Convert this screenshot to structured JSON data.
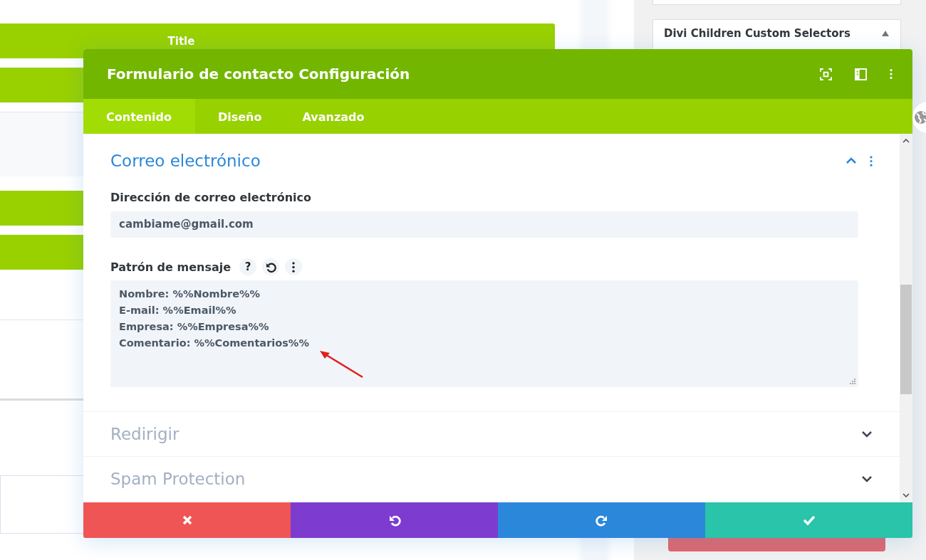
{
  "background": {
    "bar_title": "Title",
    "sidebar_panel": {
      "title": "Divi Children Custom Selectors",
      "expanded": true
    }
  },
  "modal": {
    "title": "Formulario de contacto Configuración",
    "tabs": [
      {
        "label": "Contenido",
        "selected": true
      },
      {
        "label": "Diseño",
        "selected": false
      },
      {
        "label": "Avanzado",
        "selected": false
      }
    ],
    "sections": [
      {
        "title": "Correo electrónico",
        "expanded": true,
        "fields": [
          {
            "kind": "input",
            "label": "Dirección de correo electrónico",
            "value": "cambiame@gmail.com"
          },
          {
            "kind": "textarea",
            "label": "Patrón de mensaje",
            "help_buttons": [
              "?"
            ],
            "lines": [
              "Nombre: %%Nombre%%",
              "E-mail: %%Email%%",
              "Empresa: %%Empresa%%",
              "Comentario: %%Comentarios%%"
            ]
          }
        ]
      },
      {
        "title": "Redirigir",
        "expanded": false
      },
      {
        "title": "Spam Protection",
        "expanded": false
      }
    ],
    "footer": [
      {
        "kind": "discard"
      },
      {
        "kind": "undo"
      },
      {
        "kind": "redo"
      },
      {
        "kind": "save"
      }
    ]
  }
}
